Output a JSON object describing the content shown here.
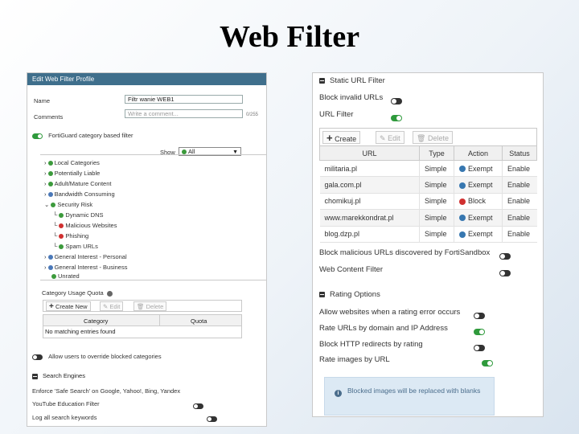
{
  "slide_title": "Web Filter",
  "left": {
    "header": "Edit Web Filter Profile",
    "name_label": "Name",
    "name_value": "Filtr wanie WEB1",
    "comments_label": "Comments",
    "comments_placeholder": "Write a comment...",
    "comments_count": "0/255",
    "fortiguard_label": "FortiGuard category based filter",
    "show_label": "Show",
    "show_value": "All",
    "tree": [
      {
        "label": "Local Categories",
        "prefix": "›",
        "icon": "green"
      },
      {
        "label": "Potentially Liable",
        "prefix": "›",
        "icon": "green"
      },
      {
        "label": "Adult/Mature Content",
        "prefix": "›",
        "icon": "green"
      },
      {
        "label": "Bandwidth Consuming",
        "prefix": "›",
        "icon": "blue"
      },
      {
        "label": "Security Risk",
        "prefix": "⌄",
        "icon": "green"
      },
      {
        "label": "Dynamic DNS",
        "prefix": "└",
        "icon": "green"
      },
      {
        "label": "Malicious Websites",
        "prefix": "└",
        "icon": "red"
      },
      {
        "label": "Phishing",
        "prefix": "└",
        "icon": "red"
      },
      {
        "label": "Spam URLs",
        "prefix": "└",
        "icon": "green"
      },
      {
        "label": "General Interest - Personal",
        "prefix": "›",
        "icon": "blue"
      },
      {
        "label": "General Interest - Business",
        "prefix": "›",
        "icon": "blue"
      },
      {
        "label": "Unrated",
        "prefix": "",
        "icon": "green"
      }
    ],
    "quota_label": "Category Usage Quota",
    "create_new": "Create New",
    "edit": "Edit",
    "delete": "Delete",
    "col_category": "Category",
    "col_quota": "Quota",
    "no_entries": "No matching entries found",
    "override_label": "Allow users to override blocked categories",
    "search_engines_label": "Search Engines",
    "safe_search_label": "Enforce 'Safe Search' on Google, Yahoo!, Bing, Yandex",
    "youtube_label": "YouTube Education Filter",
    "log_search_label": "Log all search keywords"
  },
  "right": {
    "static_url_label": "Static URL Filter",
    "block_invalid_label": "Block invalid URLs",
    "url_filter_label": "URL Filter",
    "create_label": "Create",
    "edit_label": "Edit",
    "delete_label": "Delete",
    "columns": [
      "URL",
      "Type",
      "Action",
      "Status"
    ],
    "rows": [
      {
        "url": "militaria.pl",
        "type": "Simple",
        "action": "Exempt",
        "status": "Enable",
        "icon": "exempt"
      },
      {
        "url": "gala.com.pl",
        "type": "Simple",
        "action": "Exempt",
        "status": "Enable",
        "icon": "exempt"
      },
      {
        "url": "chomikuj.pl",
        "type": "Simple",
        "action": "Block",
        "status": "Enable",
        "icon": "block"
      },
      {
        "url": "www.marekkondrat.pl",
        "type": "Simple",
        "action": "Exempt",
        "status": "Enable",
        "icon": "exempt"
      },
      {
        "url": "blog.dzp.pl",
        "type": "Simple",
        "action": "Exempt",
        "status": "Enable",
        "icon": "exempt"
      }
    ],
    "block_malicious_label": "Block malicious URLs discovered by FortiSandbox",
    "web_content_label": "Web Content Filter",
    "rating_options_label": "Rating Options",
    "allow_websites_label": "Allow websites when a rating error occurs",
    "rate_urls_label": "Rate URLs by domain and IP Address",
    "block_http_label": "Block HTTP redirects by rating",
    "rate_images_label": "Rate images by URL",
    "info_text": "Blocked images will be replaced with blanks"
  },
  "colors": {
    "header_bar": "#3f6f8c",
    "toggle_on": "#2f9a3c",
    "info_bg": "#dce9f4"
  }
}
